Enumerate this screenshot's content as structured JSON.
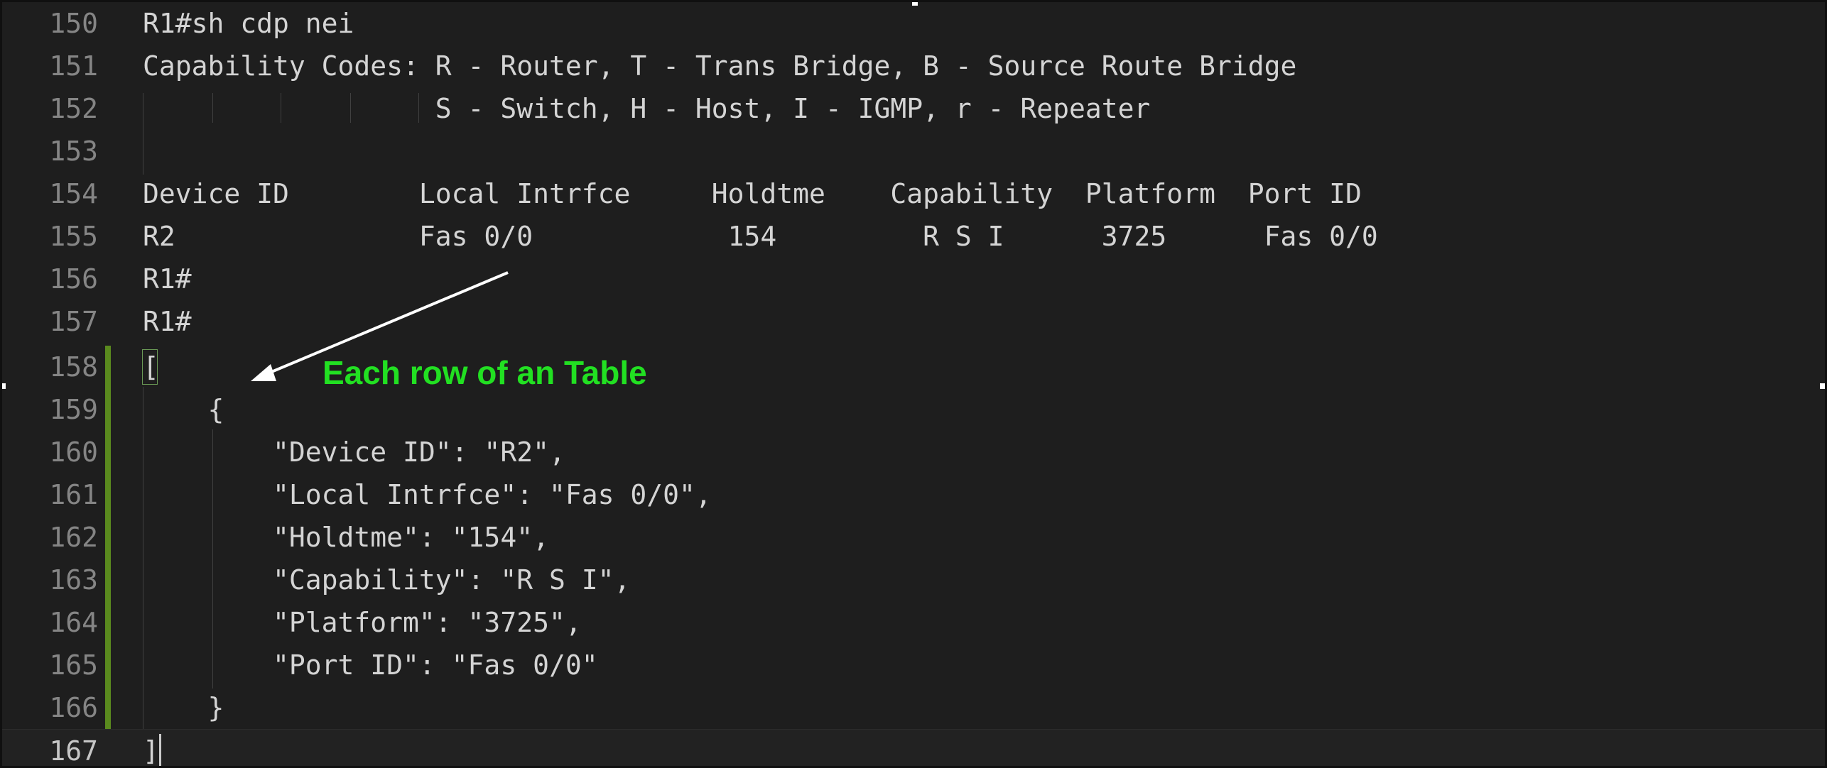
{
  "editor": {
    "lines": [
      {
        "number": "150",
        "text": "R1#sh cdp nei"
      },
      {
        "number": "151",
        "text": "Capability Codes: R - Router, T - Trans Bridge, B - Source Route Bridge"
      },
      {
        "number": "152",
        "text": "                  S - Switch, H - Host, I - IGMP, r - Repeater"
      },
      {
        "number": "153",
        "text": ""
      },
      {
        "number": "154",
        "text": "Device ID        Local Intrfce     Holdtme    Capability  Platform  Port ID"
      },
      {
        "number": "155",
        "text": "R2               Fas 0/0            154         R S I      3725      Fas 0/0"
      },
      {
        "number": "156",
        "text": "R1#"
      },
      {
        "number": "157",
        "text": "R1#"
      },
      {
        "number": "158",
        "text": "["
      },
      {
        "number": "159",
        "text": "    {"
      },
      {
        "number": "160",
        "text": "        \"Device ID\": \"R2\","
      },
      {
        "number": "161",
        "text": "        \"Local Intrfce\": \"Fas 0/0\","
      },
      {
        "number": "162",
        "text": "        \"Holdtme\": \"154\","
      },
      {
        "number": "163",
        "text": "        \"Capability\": \"R S I\","
      },
      {
        "number": "164",
        "text": "        \"Platform\": \"3725\","
      },
      {
        "number": "165",
        "text": "        \"Port ID\": \"Fas 0/0\""
      },
      {
        "number": "166",
        "text": "    }"
      },
      {
        "number": "167",
        "text": "]"
      }
    ],
    "current_line": "167"
  },
  "annotation": {
    "text": "Each row of an Table",
    "color": "#22e022"
  },
  "colors": {
    "background": "#1e1e1e",
    "code_text": "#d4d4d4",
    "line_number": "#858585",
    "modified_bar": "#5a8a1e"
  }
}
